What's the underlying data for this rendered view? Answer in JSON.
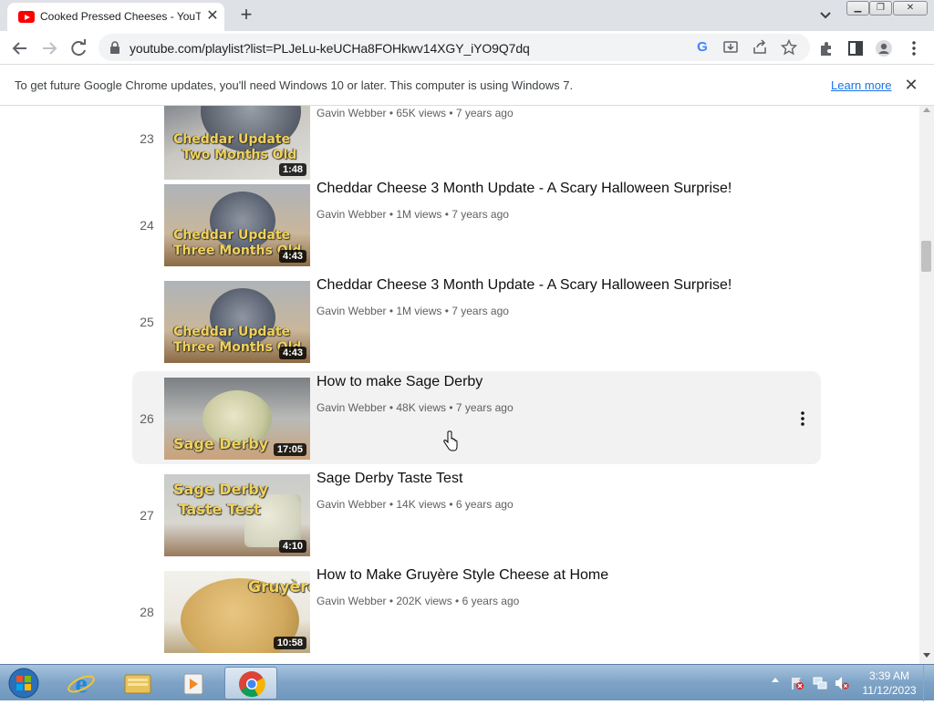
{
  "browser": {
    "tab": {
      "title": "Cooked Pressed Cheeses - YouTube",
      "icon": "youtube-icon"
    },
    "url": "youtube.com/playlist?list=PLJeLu-keUCHa8FOHkwv14XGY_iYO9Q7dq",
    "infobar": {
      "message": "To get future Google Chrome updates, you'll need Windows 10 or later. This computer is using Windows 7.",
      "learn_more": "Learn more"
    }
  },
  "playlist": {
    "items": [
      {
        "index": "23",
        "title": "",
        "meta": "Gavin Webber • 65K views • 7 years ago",
        "duration": "1:48",
        "caption": "Cheddar Update\nTwo Months Old"
      },
      {
        "index": "24",
        "title": "Cheddar Cheese 3 Month Update - A Scary Halloween Surprise!",
        "meta": "Gavin Webber • 1M views • 7 years ago",
        "duration": "4:43",
        "caption": "Cheddar Update\nThree Months Old"
      },
      {
        "index": "25",
        "title": "Cheddar Cheese 3 Month Update - A Scary Halloween Surprise!",
        "meta": "Gavin Webber • 1M views • 7 years ago",
        "duration": "4:43",
        "caption": "Cheddar Update\nThree Months Old"
      },
      {
        "index": "26",
        "title": "How to make Sage Derby",
        "meta": "Gavin Webber • 48K views • 7 years ago",
        "duration": "17:05",
        "caption": "Sage Derby"
      },
      {
        "index": "27",
        "title": "Sage Derby Taste Test",
        "meta": "Gavin Webber • 14K views • 6 years ago",
        "duration": "4:10",
        "caption": "Sage Derby\nTaste Test"
      },
      {
        "index": "28",
        "title": "How to Make Gruyère Style Cheese at Home",
        "meta": "Gavin Webber • 202K views • 6 years ago",
        "duration": "10:58",
        "caption": "Gruyère"
      }
    ]
  },
  "taskbar": {
    "time": "3:39 AM",
    "date": "11/12/2023"
  }
}
